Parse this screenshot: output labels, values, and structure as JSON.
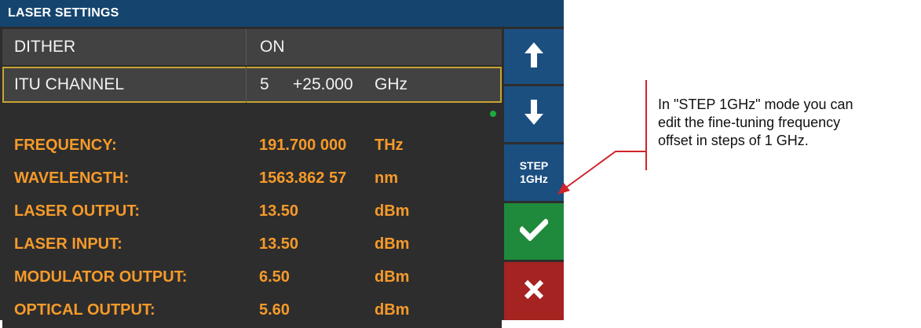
{
  "panel": {
    "title": "LASER SETTINGS"
  },
  "settings": {
    "dither": {
      "label": "DITHER",
      "value": "ON"
    },
    "itu_channel": {
      "label": "ITU CHANNEL",
      "channel": "5",
      "offset": "+25.000",
      "unit": "GHz"
    }
  },
  "readouts": [
    {
      "label": "FREQUENCY:",
      "value": "191.700 000",
      "unit": "THz"
    },
    {
      "label": "WAVELENGTH:",
      "value": "1563.862 57",
      "unit": "nm"
    },
    {
      "label": "LASER OUTPUT:",
      "value": "13.50",
      "unit": "dBm"
    },
    {
      "label": "LASER INPUT:",
      "value": "13.50",
      "unit": "dBm"
    },
    {
      "label": "MODULATOR OUTPUT:",
      "value": "6.50",
      "unit": "dBm"
    },
    {
      "label": "OPTICAL OUTPUT:",
      "value": "5.60",
      "unit": "dBm"
    }
  ],
  "buttons": {
    "up_icon": "arrow-up-icon",
    "down_icon": "arrow-down-icon",
    "step_line1": "STEP",
    "step_line2": "1GHz",
    "confirm_icon": "check-icon",
    "cancel_icon": "close-icon"
  },
  "annotation": {
    "line1": "In \"STEP 1GHz\" mode you can",
    "line2": "edit the fine-tuning frequency",
    "line3": "offset in steps of 1 GHz."
  },
  "colors": {
    "title_bar": "#15456f",
    "readout_text": "#f59a2a",
    "selected_outline": "#c8a530",
    "button_blue": "#1b4f80",
    "button_green": "#1f8a3b",
    "button_red": "#a52320",
    "status_dot": "#1faa3c",
    "annotation": "#d2232a"
  }
}
